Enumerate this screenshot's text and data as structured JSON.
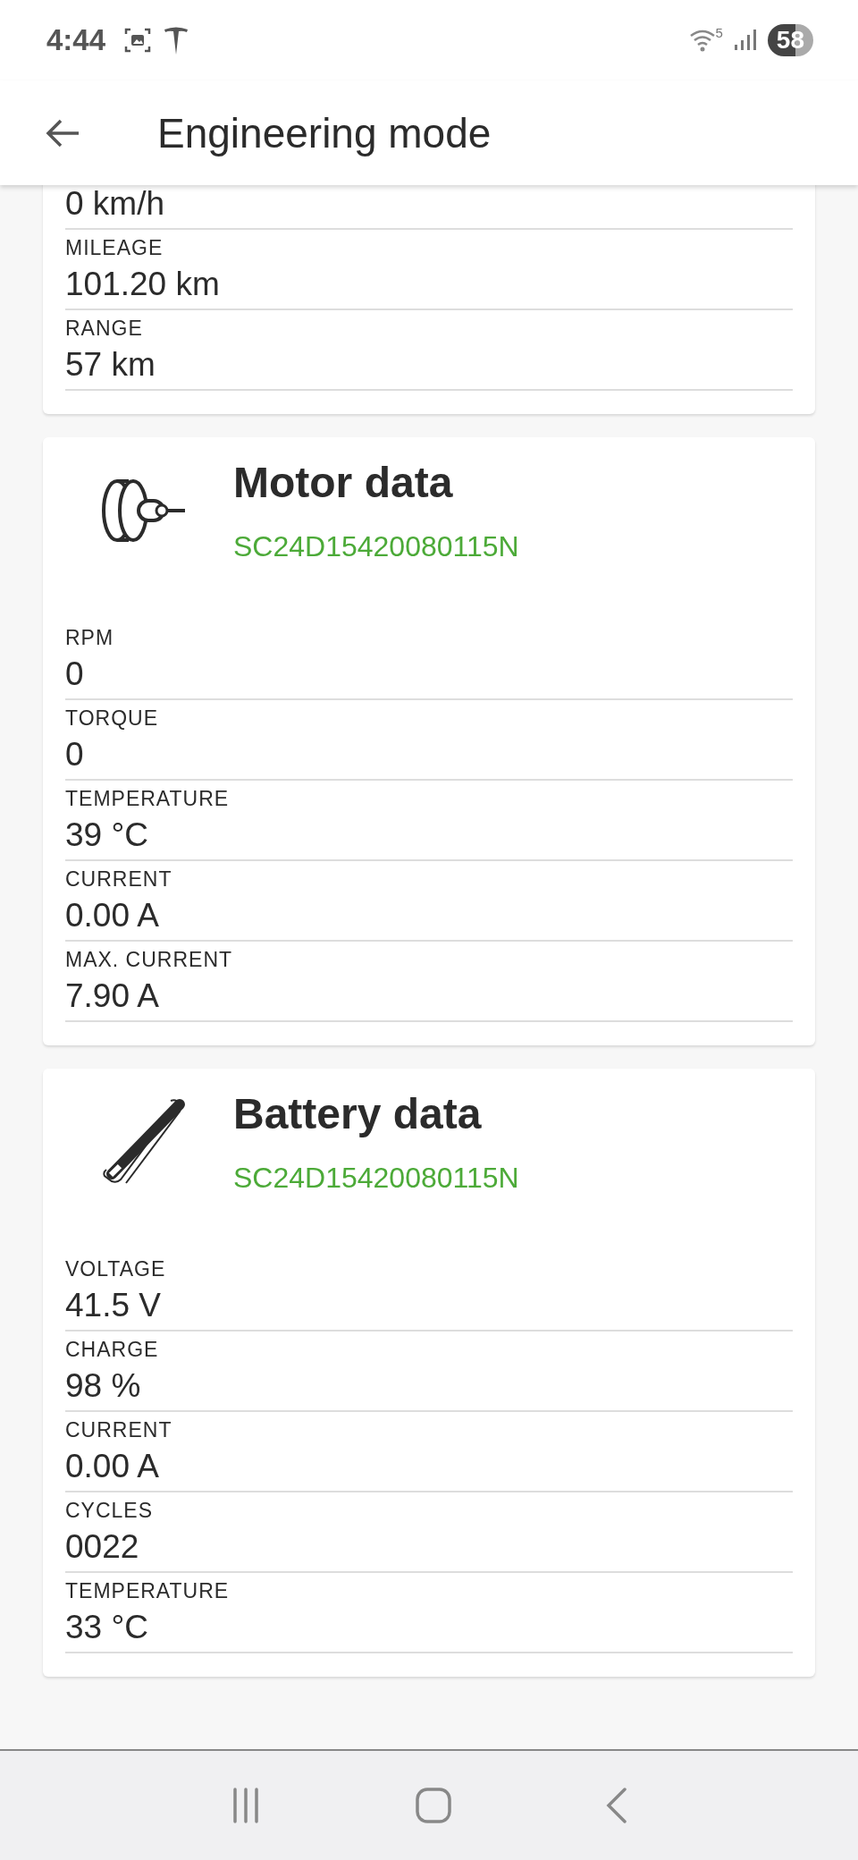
{
  "status_bar": {
    "time": "4:44",
    "network": "5",
    "battery": "58"
  },
  "app_bar": {
    "title": "Engineering mode"
  },
  "cards": [
    {
      "kind": "partial",
      "rows": [
        {
          "value": "0 km/h"
        },
        {
          "label": "MILEAGE",
          "value": "101.20 km"
        },
        {
          "label": "RANGE",
          "value": "57 km"
        }
      ]
    },
    {
      "kind": "motor",
      "title": "Motor data",
      "serial": "SC24D15420080115N",
      "rows": [
        {
          "label": "RPM",
          "value": "0"
        },
        {
          "label": "TORQUE",
          "value": "0"
        },
        {
          "label": "TEMPERATURE",
          "value": "39 °C"
        },
        {
          "label": "CURRENT",
          "value": "0.00 A"
        },
        {
          "label": "MAX. CURRENT",
          "value": "7.90 A"
        }
      ]
    },
    {
      "kind": "battery",
      "title": "Battery data",
      "serial": "SC24D15420080115N",
      "rows": [
        {
          "label": "VOLTAGE",
          "value": "41.5 V"
        },
        {
          "label": "CHARGE",
          "value": "98 %"
        },
        {
          "label": "CURRENT",
          "value": "0.00 A"
        },
        {
          "label": "CYCLES",
          "value": "0022"
        },
        {
          "label": "TEMPERATURE",
          "value": "33 °C"
        }
      ]
    }
  ]
}
